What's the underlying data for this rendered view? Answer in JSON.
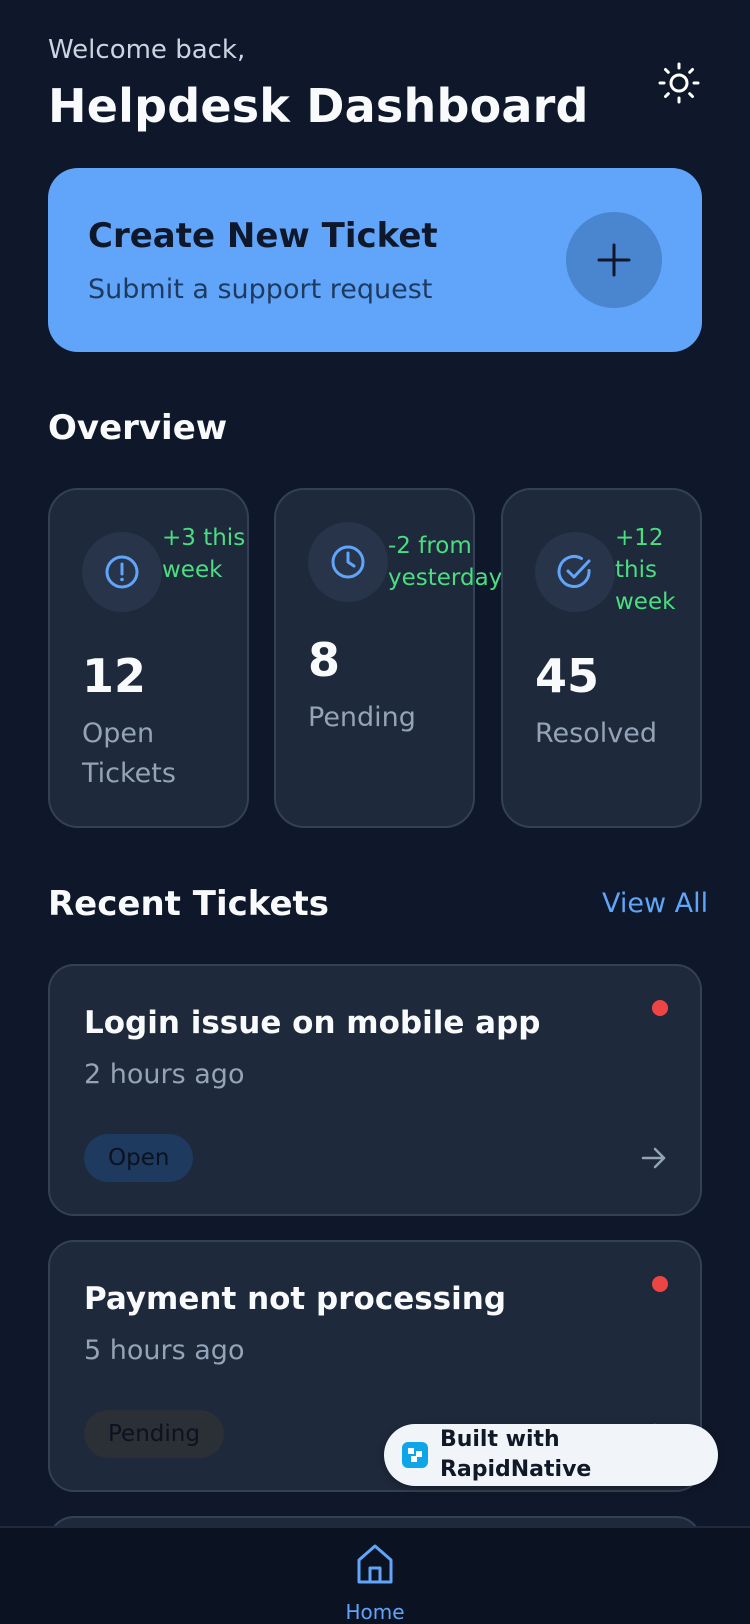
{
  "header": {
    "welcome": "Welcome back,",
    "title": "Helpdesk Dashboard"
  },
  "create_ticket": {
    "title": "Create New Ticket",
    "subtitle": "Submit a support request"
  },
  "overview": {
    "heading": "Overview",
    "stats": [
      {
        "change": "+3 this week",
        "value": "12",
        "label": "Open Tickets",
        "icon": "alert-circle-icon"
      },
      {
        "change": "-2 from yesterday",
        "value": "8",
        "label": "Pending",
        "icon": "clock-icon"
      },
      {
        "change": "+12 this week",
        "value": "45",
        "label": "Resolved",
        "icon": "check-circle-icon"
      }
    ]
  },
  "recent": {
    "heading": "Recent Tickets",
    "view_all": "View All",
    "tickets": [
      {
        "title": "Login issue on mobile app",
        "time": "2 hours ago",
        "status": "Open"
      },
      {
        "title": "Payment not processing",
        "time": "5 hours ago",
        "status": "Pending"
      }
    ]
  },
  "badge": {
    "text": "Built with RapidNative"
  },
  "nav": {
    "home_label": "Home"
  },
  "colors": {
    "background": "#0f172a",
    "card": "#1e293b",
    "accent": "#60a5fa",
    "positive": "#4ade80",
    "alert_dot": "#ef4444"
  }
}
